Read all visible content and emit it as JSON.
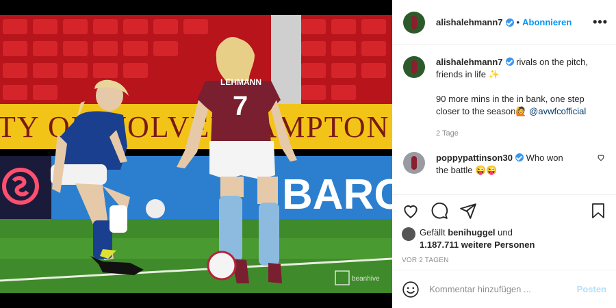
{
  "post": {
    "username": "alishalehmann7",
    "follow_label": "Abonnieren",
    "more_icon": "more-icon"
  },
  "caption": {
    "username": "alishalehmann7",
    "line1": "rivals on the pitch,",
    "line2": "friends in life",
    "emoji1": "✨",
    "line3": "90 more mins in the in bank, one step",
    "line4": "closer to the season",
    "emoji2": "🙋",
    "mention": "@avwfcofficial",
    "time": "2 Tage"
  },
  "comments": [
    {
      "username": "poppypattinson30",
      "text": "Who won",
      "text2": "the battle",
      "emoji": "😜😜"
    }
  ],
  "likes": {
    "prefix": "Gefällt",
    "user": "benihuggel",
    "middle": "und",
    "count": "1.187.711 weitere Personen"
  },
  "time_ago": "VOR 2 TAGEN",
  "comment_box": {
    "placeholder": "Kommentar hinzufügen ...",
    "post_label": "Posten"
  },
  "photo": {
    "jersey_name": "LEHMANN",
    "jersey_number": "7",
    "banner_text": "TY OF WOLVERHAMPTON",
    "ad_text": "BARC",
    "watermark": "beanhive"
  },
  "colors": {
    "accent": "#0095f6",
    "verified": "#3897f0",
    "villa_claret": "#7a1f30",
    "everton_blue": "#1b3f8f"
  }
}
